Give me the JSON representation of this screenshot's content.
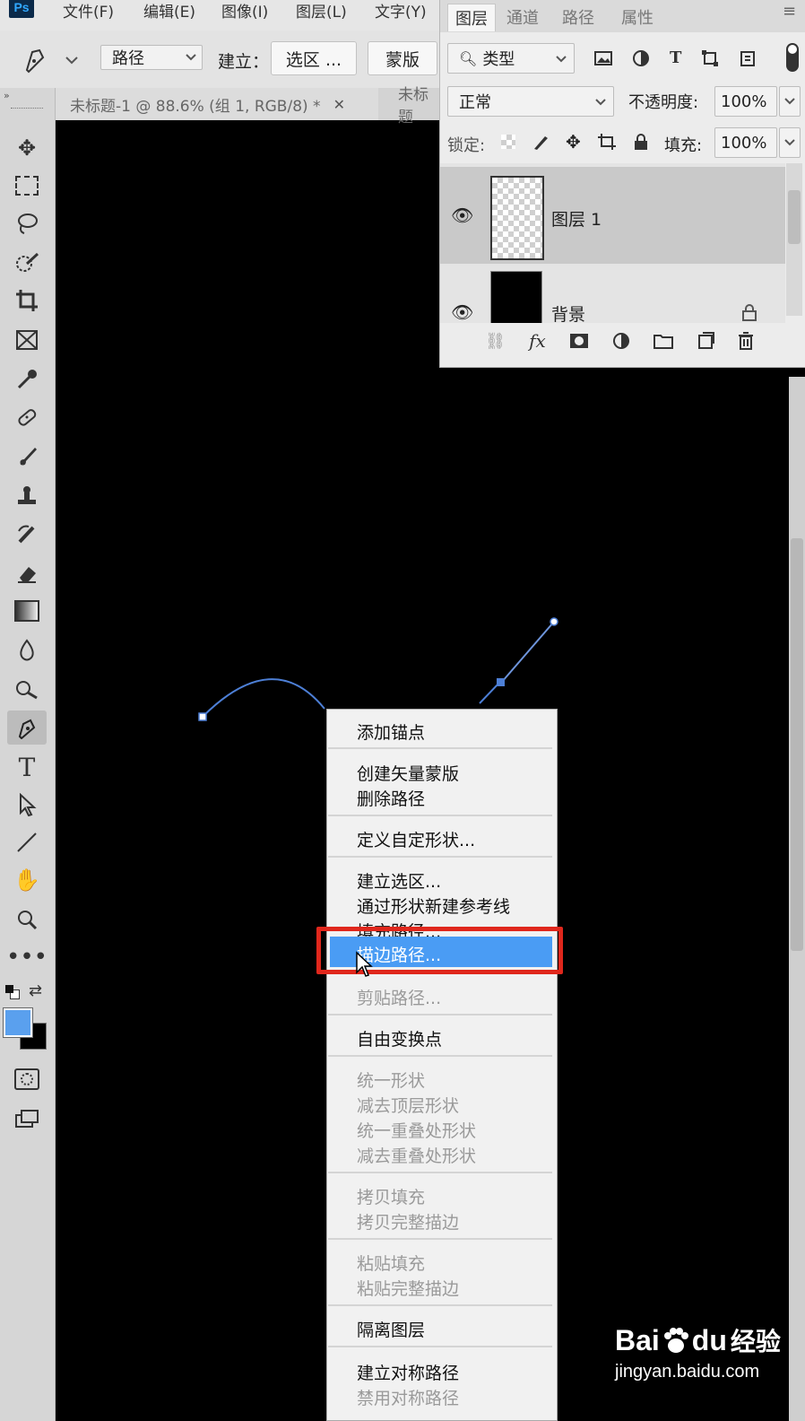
{
  "menubar": {
    "logo": "Ps",
    "items": [
      "文件(F)",
      "编辑(E)",
      "图像(I)",
      "图层(L)",
      "文字(Y)"
    ]
  },
  "options": {
    "mode_value": "路径",
    "make_label": "建立：",
    "selection_btn": "选区 ...",
    "mask_btn": "蒙版"
  },
  "tabs": {
    "active": "未标题-1 @ 88.6% (组 1, RGB/8) *",
    "second": "未标题"
  },
  "layers_panel": {
    "tabs": [
      "图层",
      "通道",
      "路径",
      "属性"
    ],
    "filter_label": "类型",
    "blend_mode": "正常",
    "opacity_label": "不透明度:",
    "opacity_value": "100%",
    "lock_label": "锁定:",
    "fill_label": "填充:",
    "fill_value": "100%",
    "layers": [
      {
        "name": "图层 1",
        "selected": true
      },
      {
        "name": "背景",
        "locked": true
      }
    ]
  },
  "context_menu": {
    "groups": [
      [
        {
          "label": "添加锚点",
          "enabled": true
        }
      ],
      [
        {
          "label": "创建矢量蒙版",
          "enabled": true
        },
        {
          "label": "删除路径",
          "enabled": true
        }
      ],
      [
        {
          "label": "定义自定形状...",
          "enabled": true
        }
      ],
      [
        {
          "label": "建立选区...",
          "enabled": true
        },
        {
          "label": "通过形状新建参考线",
          "enabled": true
        },
        {
          "label": "填充路径...",
          "enabled": true
        },
        {
          "label": "描边路径...",
          "enabled": true,
          "highlighted": true
        },
        {
          "label": "剪贴路径...",
          "enabled": false
        }
      ],
      [
        {
          "label": "自由变换点",
          "enabled": true
        }
      ],
      [
        {
          "label": "统一形状",
          "enabled": false
        },
        {
          "label": "减去顶层形状",
          "enabled": false
        },
        {
          "label": "统一重叠处形状",
          "enabled": false
        },
        {
          "label": "减去重叠处形状",
          "enabled": false
        }
      ],
      [
        {
          "label": "拷贝填充",
          "enabled": false
        },
        {
          "label": "拷贝完整描边",
          "enabled": false
        }
      ],
      [
        {
          "label": "粘贴填充",
          "enabled": false
        },
        {
          "label": "粘贴完整描边",
          "enabled": false
        }
      ],
      [
        {
          "label": "隔离图层",
          "enabled": true
        }
      ],
      [
        {
          "label": "建立对称路径",
          "enabled": true
        },
        {
          "label": "禁用对称路径",
          "enabled": false
        }
      ]
    ]
  },
  "colors": {
    "foreground": "#5aa0ee",
    "background": "#000000",
    "highlight": "#4a9cf4",
    "annotation": "#e0271c"
  },
  "watermark": {
    "brand": "Bai",
    "brand2": "du",
    "brand_cn": "经验",
    "url": "jingyan.baidu.com"
  }
}
